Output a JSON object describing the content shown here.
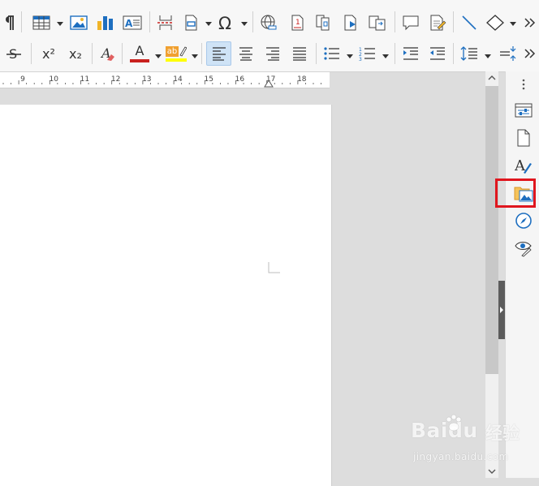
{
  "toolbar_top": {
    "items": [
      {
        "name": "formatting-marks-icon"
      },
      {
        "name": "insert-table-icon"
      },
      {
        "name": "insert-image-icon"
      },
      {
        "name": "insert-chart-icon"
      },
      {
        "name": "insert-text-box-icon"
      },
      {
        "name": "insert-page-break-icon"
      },
      {
        "name": "insert-field-icon"
      },
      {
        "name": "insert-special-character-icon"
      },
      {
        "name": "insert-hyperlink-icon"
      },
      {
        "name": "insert-footnote-icon"
      },
      {
        "name": "insert-cross-reference-icon"
      },
      {
        "name": "insert-bookmark-icon"
      },
      {
        "name": "insert-comment-icon"
      },
      {
        "name": "track-changes-icon"
      },
      {
        "name": "insert-line-icon"
      },
      {
        "name": "basic-shapes-icon"
      },
      {
        "name": "more-options-icon"
      }
    ]
  },
  "toolbar_format": {
    "superscript_label": "x²",
    "subscript_label": "x₂",
    "font_color_label": "A",
    "font_color": "#c9211e",
    "highlight_label": "ab",
    "highlight_color": "#ffff00",
    "active_item": "align-left"
  },
  "ruler": {
    "labels": [
      "9",
      "10",
      "11",
      "12",
      "13",
      "14",
      "15",
      "16",
      "17",
      "18"
    ]
  },
  "sidebar": {
    "items": [
      {
        "name": "sidebar-menu-icon"
      },
      {
        "name": "properties-icon"
      },
      {
        "name": "page-icon"
      },
      {
        "name": "styles-icon"
      },
      {
        "name": "gallery-icon",
        "highlighted": true
      },
      {
        "name": "navigator-icon"
      },
      {
        "name": "manage-changes-icon"
      }
    ]
  },
  "watermark": {
    "logo": "Baidu",
    "cn": "经验",
    "url": "jingyan.baidu.com"
  },
  "colors": {
    "accent": "#1e6fc0",
    "highlight_border": "#e0161e",
    "active_button": "#cfe3f6"
  }
}
